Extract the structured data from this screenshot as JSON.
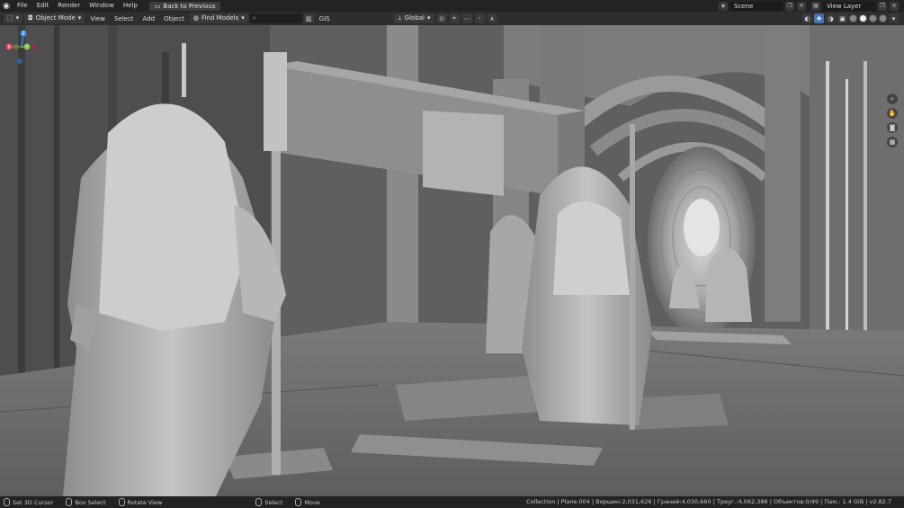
{
  "menubar": {
    "items": [
      "File",
      "Edit",
      "Render",
      "Window",
      "Help"
    ],
    "back_button": "Back to Previous",
    "scene_label": "Scene",
    "view_layer_label": "View Layer"
  },
  "header": {
    "mode": "Object Mode",
    "menus": [
      "View",
      "Select",
      "Add",
      "Object"
    ],
    "find_models": "Find Models",
    "search_placeholder": "",
    "gis": "GIS",
    "orientation": "Global"
  },
  "gizmo": {
    "x_label": "X",
    "y_label": "Y",
    "z_label": "Z",
    "colors": {
      "x": "#e84a5f",
      "y": "#7fc241",
      "z": "#3f8ceb"
    }
  },
  "statusbar": {
    "hints": [
      "Set 3D Cursor",
      "Box Select",
      "Rotate View",
      "Select",
      "Move"
    ],
    "info": "Collection | Plane.004 | Вершин:2,031,626 | Граней:4,030,660 | Треуг.:4,062,386 | Объектов:0/49 | Пам.: 1.4 GiB | v2.82.7"
  },
  "icons": {
    "logo": "blender-logo-icon",
    "back": "back-icon"
  }
}
